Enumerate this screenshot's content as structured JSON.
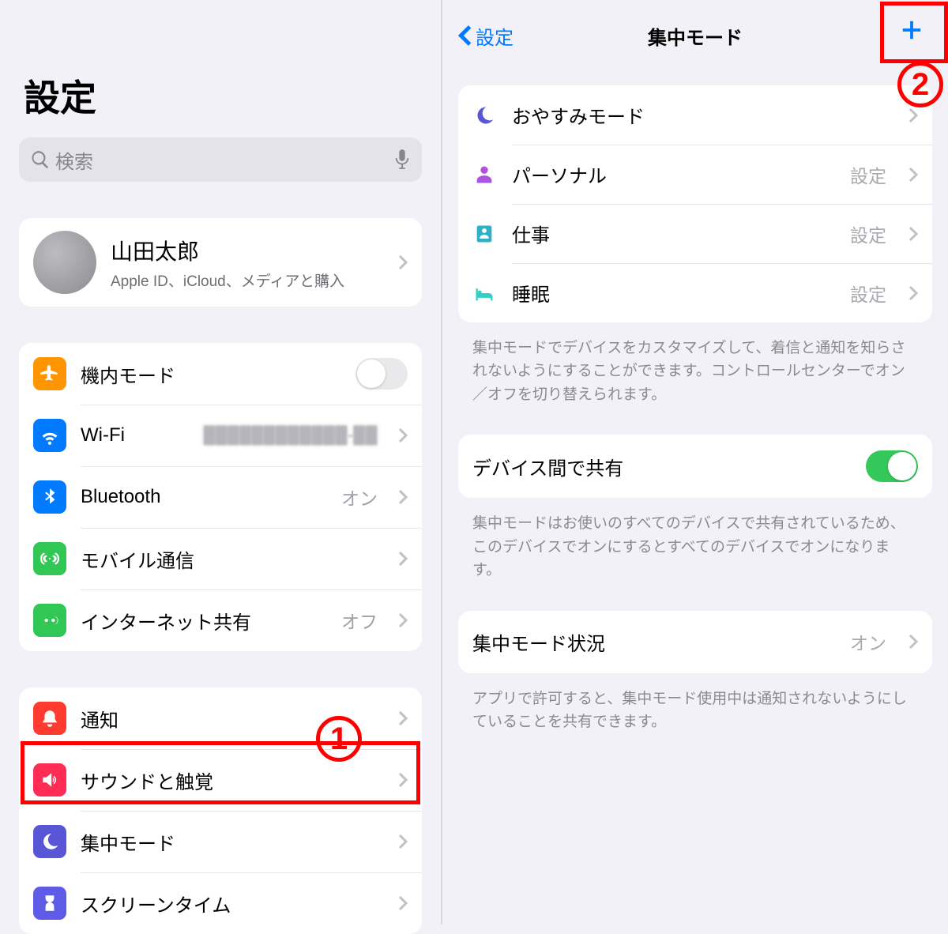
{
  "left": {
    "title": "設定",
    "search_placeholder": "検索",
    "profile": {
      "name": "山田太郎",
      "sub": "Apple ID、iCloud、メディアと購入"
    },
    "network": {
      "airplane": "機内モード",
      "wifi_label": "Wi-Fi",
      "wifi_value": "████████████-██",
      "bluetooth_label": "Bluetooth",
      "bluetooth_value": "オン",
      "cellular": "モバイル通信",
      "hotspot_label": "インターネット共有",
      "hotspot_value": "オフ"
    },
    "system": {
      "notifications": "通知",
      "sounds": "サウンドと触覚",
      "focus": "集中モード",
      "screentime": "スクリーンタイム"
    }
  },
  "right": {
    "back": "設定",
    "title": "集中モード",
    "modes": {
      "dnd": "おやすみモード",
      "personal_label": "パーソナル",
      "personal_value": "設定",
      "work_label": "仕事",
      "work_value": "設定",
      "sleep_label": "睡眠",
      "sleep_value": "設定"
    },
    "modes_footer": "集中モードでデバイスをカスタマイズして、着信と通知を知らされないようにすることができます。コントロールセンターでオン／オフを切り替えられます。",
    "share_label": "デバイス間で共有",
    "share_footer": "集中モードはお使いのすべてのデバイスで共有されているため、このデバイスでオンにするとすべてのデバイスでオンになります。",
    "status_label": "集中モード状況",
    "status_value": "オン",
    "status_footer": "アプリで許可すると、集中モード使用中は通知されないようにしていることを共有できます。"
  },
  "annotations": {
    "one": "1",
    "two": "2"
  }
}
